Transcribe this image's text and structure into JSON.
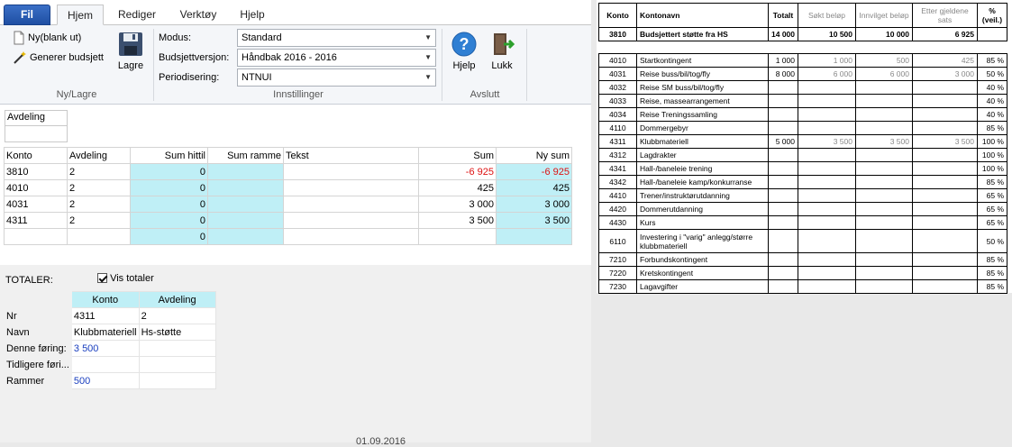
{
  "ribbon_tabs": [
    "Fil",
    "Hjem",
    "Rediger",
    "Verktøy",
    "Hjelp"
  ],
  "ribbon": {
    "new_blank": "Ny(blank ut)",
    "generate": "Generer budsjett",
    "save": "Lagre",
    "group_new": "Ny/Lagre",
    "modus_label": "Modus:",
    "modus_value": "Standard",
    "budget_label": "Budsjettversjon:",
    "budget_value": "Håndbak 2016 - 2016",
    "period_label": "Periodisering:",
    "period_value": "NTNUI",
    "group_settings": "Innstillinger",
    "help": "Hjelp",
    "close": "Lukk",
    "group_exit": "Avslutt"
  },
  "filter": {
    "header": "Avdeling",
    "value": ""
  },
  "grid": {
    "headers": [
      "Konto",
      "Avdeling",
      "Sum hittil",
      "Sum ramme",
      "Tekst",
      "Sum",
      "Ny sum"
    ],
    "rows": [
      [
        "3810",
        "2",
        "0",
        "",
        "",
        "-6 925",
        "-6 925"
      ],
      [
        "4010",
        "2",
        "0",
        "",
        "",
        "425",
        "425"
      ],
      [
        "4031",
        "2",
        "0",
        "",
        "",
        "3 000",
        "3 000"
      ],
      [
        "4311",
        "2",
        "0",
        "",
        "",
        "3 500",
        "3 500"
      ],
      [
        "",
        "",
        "0",
        "",
        "",
        "",
        ""
      ]
    ]
  },
  "totals": {
    "label": "TOTALER:",
    "show_label": "Vis totaler",
    "col_konto": "Konto",
    "col_avdeling": "Avdeling",
    "rows": [
      [
        "Nr",
        "4311",
        "2"
      ],
      [
        "Navn",
        "Klubbmateriell",
        "Hs-støtte"
      ],
      [
        "Denne føring:",
        "3 500",
        ""
      ],
      [
        "Tidligere føri...",
        "",
        ""
      ],
      [
        "Rammer",
        "500",
        ""
      ]
    ]
  },
  "document": {
    "headers": [
      "Konto",
      "Kontonavn",
      "Totalt",
      "Søkt beløp",
      "Innvilget beløp",
      "Etter gjeldene sats",
      "% (veil.)"
    ],
    "top_row": [
      "3810",
      "Budsjettert støtte fra HS",
      "14 000",
      "10 500",
      "10 000",
      "6 925",
      ""
    ],
    "rows": [
      [
        "4010",
        "Startkontingent",
        "1 000",
        "1 000",
        "500",
        "425",
        "85 %"
      ],
      [
        "4031",
        "Reise buss/bil/tog/fly",
        "8 000",
        "6 000",
        "6 000",
        "3 000",
        "50 %"
      ],
      [
        "4032",
        "Reise SM buss/bil/tog/fly",
        "",
        "",
        "",
        "",
        "40 %"
      ],
      [
        "4033",
        "Reise, massearrangement",
        "",
        "",
        "",
        "",
        "40 %"
      ],
      [
        "4034",
        "Reise Treningssamling",
        "",
        "",
        "",
        "",
        "40 %"
      ],
      [
        "4110",
        "Dommergebyr",
        "",
        "",
        "",
        "",
        "85 %"
      ],
      [
        "4311",
        "Klubbmateriell",
        "5 000",
        "3 500",
        "3 500",
        "3 500",
        "100 %"
      ],
      [
        "4312",
        "Lagdrakter",
        "",
        "",
        "",
        "",
        "100 %"
      ],
      [
        "4341",
        "Hall-/baneleie trening",
        "",
        "",
        "",
        "",
        "100 %"
      ],
      [
        "4342",
        "Hall-/baneleie kamp/konkurranse",
        "",
        "",
        "",
        "",
        "85 %"
      ],
      [
        "4410",
        "Trener/instruktørutdanning",
        "",
        "",
        "",
        "",
        "65 %"
      ],
      [
        "4420",
        "Dommerutdanning",
        "",
        "",
        "",
        "",
        "65 %"
      ],
      [
        "4430",
        "Kurs",
        "",
        "",
        "",
        "",
        "65 %"
      ],
      [
        "6110",
        "Investering i \"varig\" anlegg/større klubbmateriell",
        "",
        "",
        "",
        "",
        "50 %"
      ],
      [
        "7210",
        "Forbundskontingent",
        "",
        "",
        "",
        "",
        "85 %"
      ],
      [
        "7220",
        "Kretskontingent",
        "",
        "",
        "",
        "",
        "85 %"
      ],
      [
        "7230",
        "Lagavgifter",
        "",
        "",
        "",
        "",
        "85 %"
      ]
    ],
    "footer_partial": "01.09.2016"
  },
  "colors": {
    "cyan": "#bfeff6",
    "negative": "#d11111",
    "link_blue": "#1a3fbf",
    "file_tab": "#2a5db5"
  }
}
